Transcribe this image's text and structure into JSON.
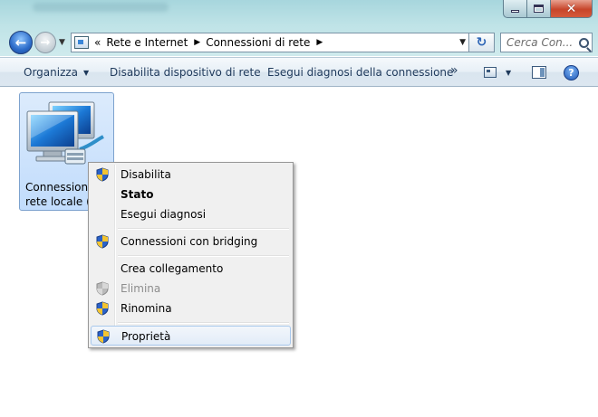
{
  "titlebar": {
    "controls": {
      "minimize": "minimize",
      "maximize": "maximize",
      "close": "✕"
    }
  },
  "nav": {
    "back_icon": "back-arrow-icon",
    "forward_icon": "forward-arrow-icon"
  },
  "address": {
    "prefix": "«",
    "segments": [
      "Rete e Internet",
      "Connessioni di rete"
    ]
  },
  "search": {
    "placeholder": "Cerca Con..."
  },
  "toolbar": {
    "organize": "Organizza",
    "disable_device": "Disabilita dispositivo di rete",
    "diagnose": "Esegui diagnosi della connessione",
    "more": "»",
    "help": "?"
  },
  "file_item": {
    "line1": "Connessione",
    "line2": "rete locale (L",
    "selected": true
  },
  "context_menu": {
    "items": [
      {
        "label": "Disabilita",
        "shield": true,
        "bold": false,
        "disabled": false
      },
      {
        "label": "Stato",
        "shield": false,
        "bold": true,
        "disabled": false
      },
      {
        "label": "Esegui diagnosi",
        "shield": false,
        "bold": false,
        "disabled": false
      },
      {
        "label": "Connessioni con bridging",
        "shield": true,
        "bold": false,
        "disabled": false
      },
      {
        "label": "Crea collegamento",
        "shield": false,
        "bold": false,
        "disabled": false
      },
      {
        "label": "Elimina",
        "shield": true,
        "bold": false,
        "disabled": true
      },
      {
        "label": "Rinomina",
        "shield": true,
        "bold": false,
        "disabled": false
      },
      {
        "label": "Proprietà",
        "shield": true,
        "bold": false,
        "disabled": false,
        "highlighted": true
      }
    ]
  },
  "colors": {
    "accent": "#1e395b",
    "selection": "#c1dcfc",
    "menu_bg": "#f0f0f0"
  }
}
